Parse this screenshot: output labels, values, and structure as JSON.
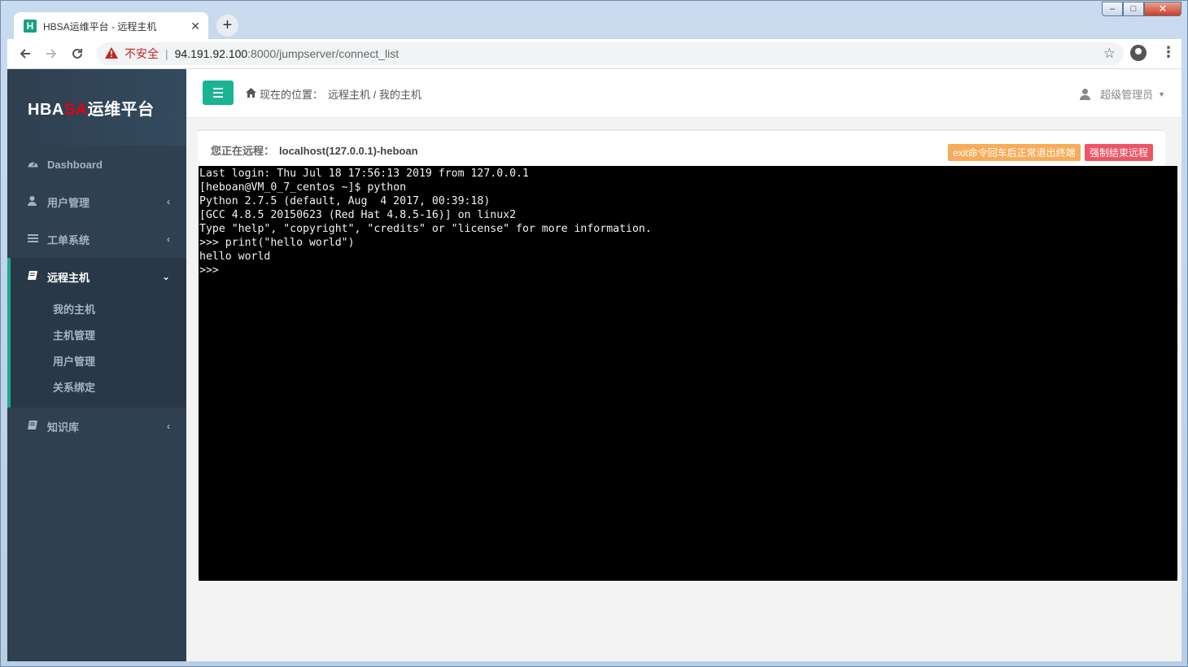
{
  "browser": {
    "tab_title": "HBSA运维平台 - 远程主机",
    "favicon_letter": "H",
    "tab_close": "✕",
    "new_tab": "+",
    "insecure_label": "不安全",
    "url_host": "94.191.92.100",
    "url_path": ":8000/jumpserver/connect_list",
    "window_controls": {
      "minimize": "–",
      "maximize": "□",
      "close": "✕"
    }
  },
  "sidebar": {
    "logo_prefix": "HBA",
    "logo_highlight": "SA",
    "logo_suffix": "运维平台",
    "items": [
      {
        "label": "Dashboard",
        "icon": "dashboard-icon"
      },
      {
        "label": "用户管理",
        "icon": "user-icon",
        "arrow": "‹"
      },
      {
        "label": "工单系统",
        "icon": "list-icon",
        "arrow": "‹"
      },
      {
        "label": "远程主机",
        "icon": "book-icon",
        "arrow": "⌄",
        "active": true,
        "children": [
          "我的主机",
          "主机管理",
          "用户管理",
          "关系绑定"
        ]
      },
      {
        "label": "知识库",
        "icon": "book-icon",
        "arrow": "‹"
      }
    ]
  },
  "topbar": {
    "breadcrumb_label": "现在的位置：",
    "breadcrumb_path": "远程主机 / 我的主机",
    "user_name": "超级管理员",
    "caret": "▼"
  },
  "panel": {
    "title_label": "您正在远程：",
    "host": "localhost(127.0.0.1)-heboan",
    "exit_button": "exit命令回车后正常退出终端",
    "kill_button": "强制结束远程"
  },
  "terminal": {
    "lines": [
      "Last login: Thu Jul 18 17:56:13 2019 from 127.0.0.1",
      "[heboan@VM_0_7_centos ~]$ python",
      "Python 2.7.5 (default, Aug  4 2017, 00:39:18)",
      "[GCC 4.8.5 20150623 (Red Hat 4.8.5-16)] on linux2",
      "Type \"help\", \"copyright\", \"credits\" or \"license\" for more information.",
      ">>> print(\"hello world\")",
      "hello world",
      ">>>"
    ]
  },
  "colors": {
    "sidebar_bg": "#2f4050",
    "accent": "#1ab394",
    "warning": "#f8ac59",
    "danger": "#ed5565",
    "logo_highlight": "#e60012"
  }
}
